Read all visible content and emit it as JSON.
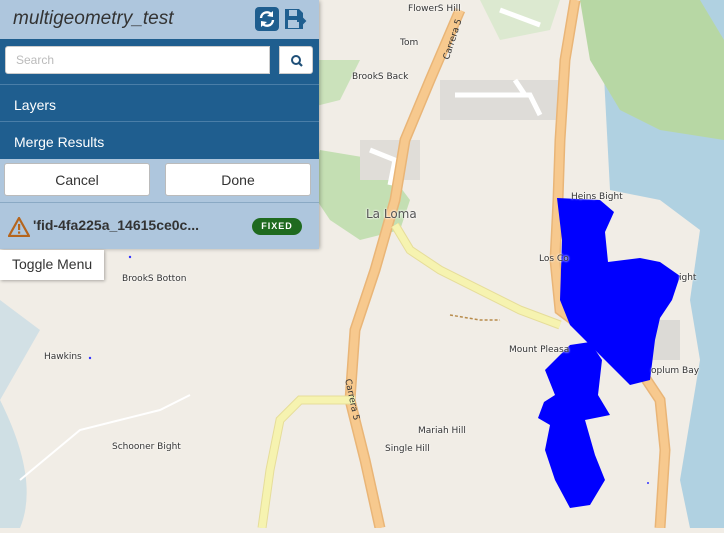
{
  "panel": {
    "title": "multigeometry_test",
    "search_placeholder": "Search",
    "layers_label": "Layers",
    "merge_label": "Merge Results",
    "cancel_label": "Cancel",
    "done_label": "Done",
    "result_text": "'fid-4fa225a_14615ce0c...",
    "result_badge": "FIXED",
    "toggle_menu_label": "Toggle Menu",
    "icons": [
      "refresh-icon",
      "save-icon",
      "search-icon",
      "warning-icon"
    ]
  },
  "map": {
    "labels": {
      "flowers_hill": "FlowerS Hill",
      "tom": "Tom",
      "brooks_back": "BrookS Back",
      "la_loma": "La Loma",
      "heins_bight": "Heins Bight",
      "los_c": "Los Co",
      "ight": "ight",
      "brooks_botton": "BrookS Botton",
      "hawkins": "Hawkins",
      "mount_pleasant": "Mount Pleasa",
      "oplum_bay": "oplum Bay",
      "schooner_bight": "Schooner Bight",
      "mariah_hill": "Mariah Hill",
      "single_hill": "Single Hill",
      "carrera_top": "Carrera 5",
      "carrera_bottom": "Carrera 5"
    },
    "colors": {
      "land": "#f1ede6",
      "road": "#f7c98e",
      "road_yellow": "#f6f3b0",
      "forest": "#b9d8a6",
      "water": "#9ec5dc",
      "geometry": "#0000ff"
    }
  }
}
